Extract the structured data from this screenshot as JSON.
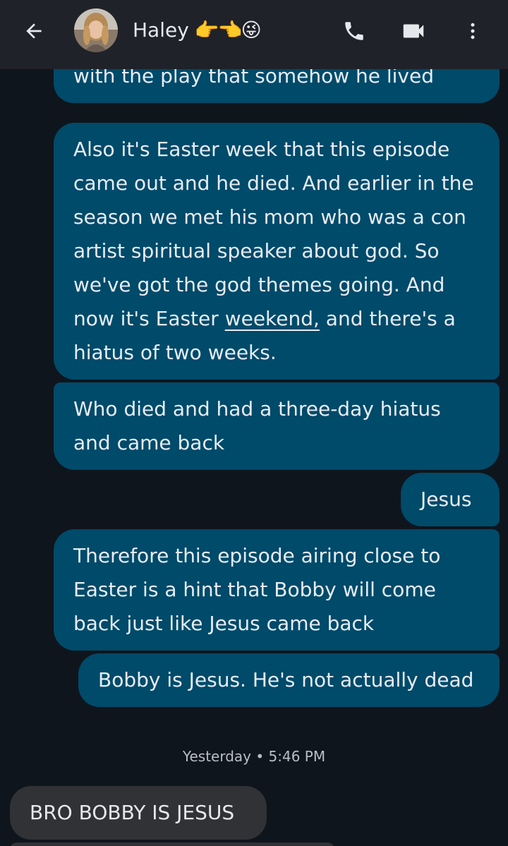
{
  "header": {
    "contact_name": "Haley",
    "contact_emoji": "👉👈😜",
    "icons": [
      "back-arrow-icon",
      "avatar",
      "phone-icon",
      "video-icon",
      "more-vert-icon"
    ]
  },
  "messages": {
    "out_1": "with the play that somehow he lived",
    "out_2_before": "Also it's Easter week that this episode\ncame out and he died. And earlier in the\nseason we met his mom who was a con\nartist spiritual speaker about god. So\nwe've got the god themes going. And\nnow it's Easter ",
    "out_2_link": "weekend,",
    "out_2_after": " and there's a\nhiatus of two weeks.",
    "out_3": "Who died and had a three-day hiatus\nand came back",
    "out_4": "Jesus",
    "out_5": "Therefore this episode airing close to\nEaster is a hint that Bobby will come\nback just like Jesus came back",
    "out_6": "Bobby is Jesus. He's not actually dead",
    "timestamp": "Yesterday • 5:46 PM",
    "in_1": "BRO BOBBY IS JESUS"
  },
  "colors": {
    "background": "#0f151c",
    "header": "#1f2228",
    "outgoing_bubble": "#004a6a",
    "incoming_bubble": "#303236",
    "text": "#e6edf3"
  }
}
